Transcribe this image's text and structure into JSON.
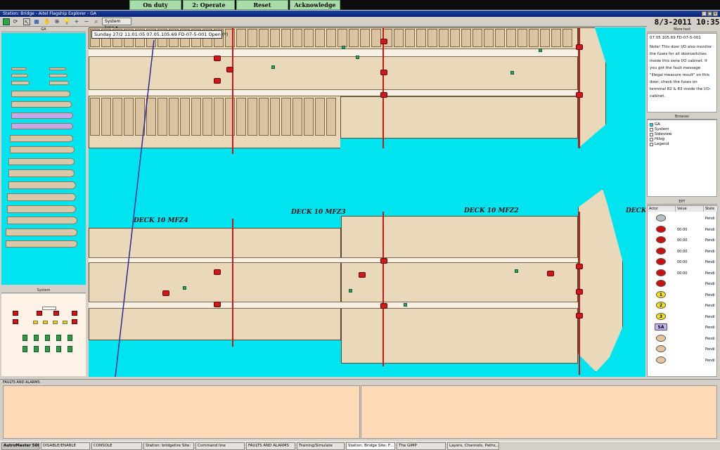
{
  "top_bar": {
    "buttons": [
      "On duty",
      "2: Operate",
      "Reset",
      "Acknowledge"
    ]
  },
  "window": {
    "title": "Station: Bridge - Aitel Flagship Explorer - GA"
  },
  "toolbar": {
    "system_type": "System type"
  },
  "datetime": "8/3-2011  10:35",
  "event_bar": "Sunday 27/2 11:01:05   07.05.105.69 FD-07-5-001 Open (*)",
  "ga_panel": {
    "title": "GA"
  },
  "system_panel": {
    "title": "System"
  },
  "deck_labels": [
    "DECK 10 MFZ4",
    "DECK 10 MFZ3",
    "DECK 10 MFZ2",
    "DECK"
  ],
  "more_text": {
    "title": "More text",
    "id_line": "07.05.105.69 FD-07-5-001",
    "body": "Note! This door I/O also monitor the fuses for all doorswitches inside this zone I/O cabinet. If you got the fault message \"illegal measure result\" on this door, check the fuses on terminal 82 & 83 inside the I/O-cabinet."
  },
  "browser": {
    "title": "Browser",
    "items": [
      "GA",
      "System",
      "Sideview",
      "Hilog",
      "Legend"
    ]
  },
  "ept": {
    "title": "EPT",
    "columns": [
      "Actor",
      "Value",
      "State"
    ],
    "rows": [
      {
        "icon": "arrow",
        "value": "",
        "state": "Pendi"
      },
      {
        "icon": "red",
        "value": "00:00",
        "state": "Pendi"
      },
      {
        "icon": "red",
        "value": "00:00",
        "state": "Pendi"
      },
      {
        "icon": "red",
        "value": "00:00",
        "state": "Pendi"
      },
      {
        "icon": "red",
        "value": "00:00",
        "state": "Pendi"
      },
      {
        "icon": "red",
        "value": "00:00",
        "state": "Pendi"
      },
      {
        "icon": "red",
        "value": "",
        "state": "Pendi"
      },
      {
        "icon": "yellow",
        "value": "1",
        "state": "Pendi"
      },
      {
        "icon": "yellow",
        "value": "2",
        "state": "Pendi"
      },
      {
        "icon": "yellow",
        "value": "3",
        "state": "Pendi"
      },
      {
        "icon": "sa",
        "value": "SA",
        "state": "Pendi"
      },
      {
        "icon": "tan",
        "value": "",
        "state": "Pendi"
      },
      {
        "icon": "tan",
        "value": "",
        "state": "Pendi"
      },
      {
        "icon": "tan",
        "value": "",
        "state": "Pendi"
      }
    ]
  },
  "faults": {
    "title": "FAULTS AND ALARMS"
  },
  "taskbar": {
    "items": [
      "AutroMaster 5000",
      "DISABLE/ENABLE",
      "CONSOLE",
      "Station: bridgetire  Site:",
      "Command line",
      "FAULTS AND ALARMS",
      "Training/Simulate",
      "Station: Bridge  Site: F...",
      "The GIMP",
      "Layers, Channels, Paths,..."
    ]
  },
  "colors": {
    "water": "#00e4f0",
    "deck": "#e9d8b9",
    "alarm": "#d01818",
    "fire_zone": "#c71818",
    "faults_bg": "#fdd9b6"
  }
}
